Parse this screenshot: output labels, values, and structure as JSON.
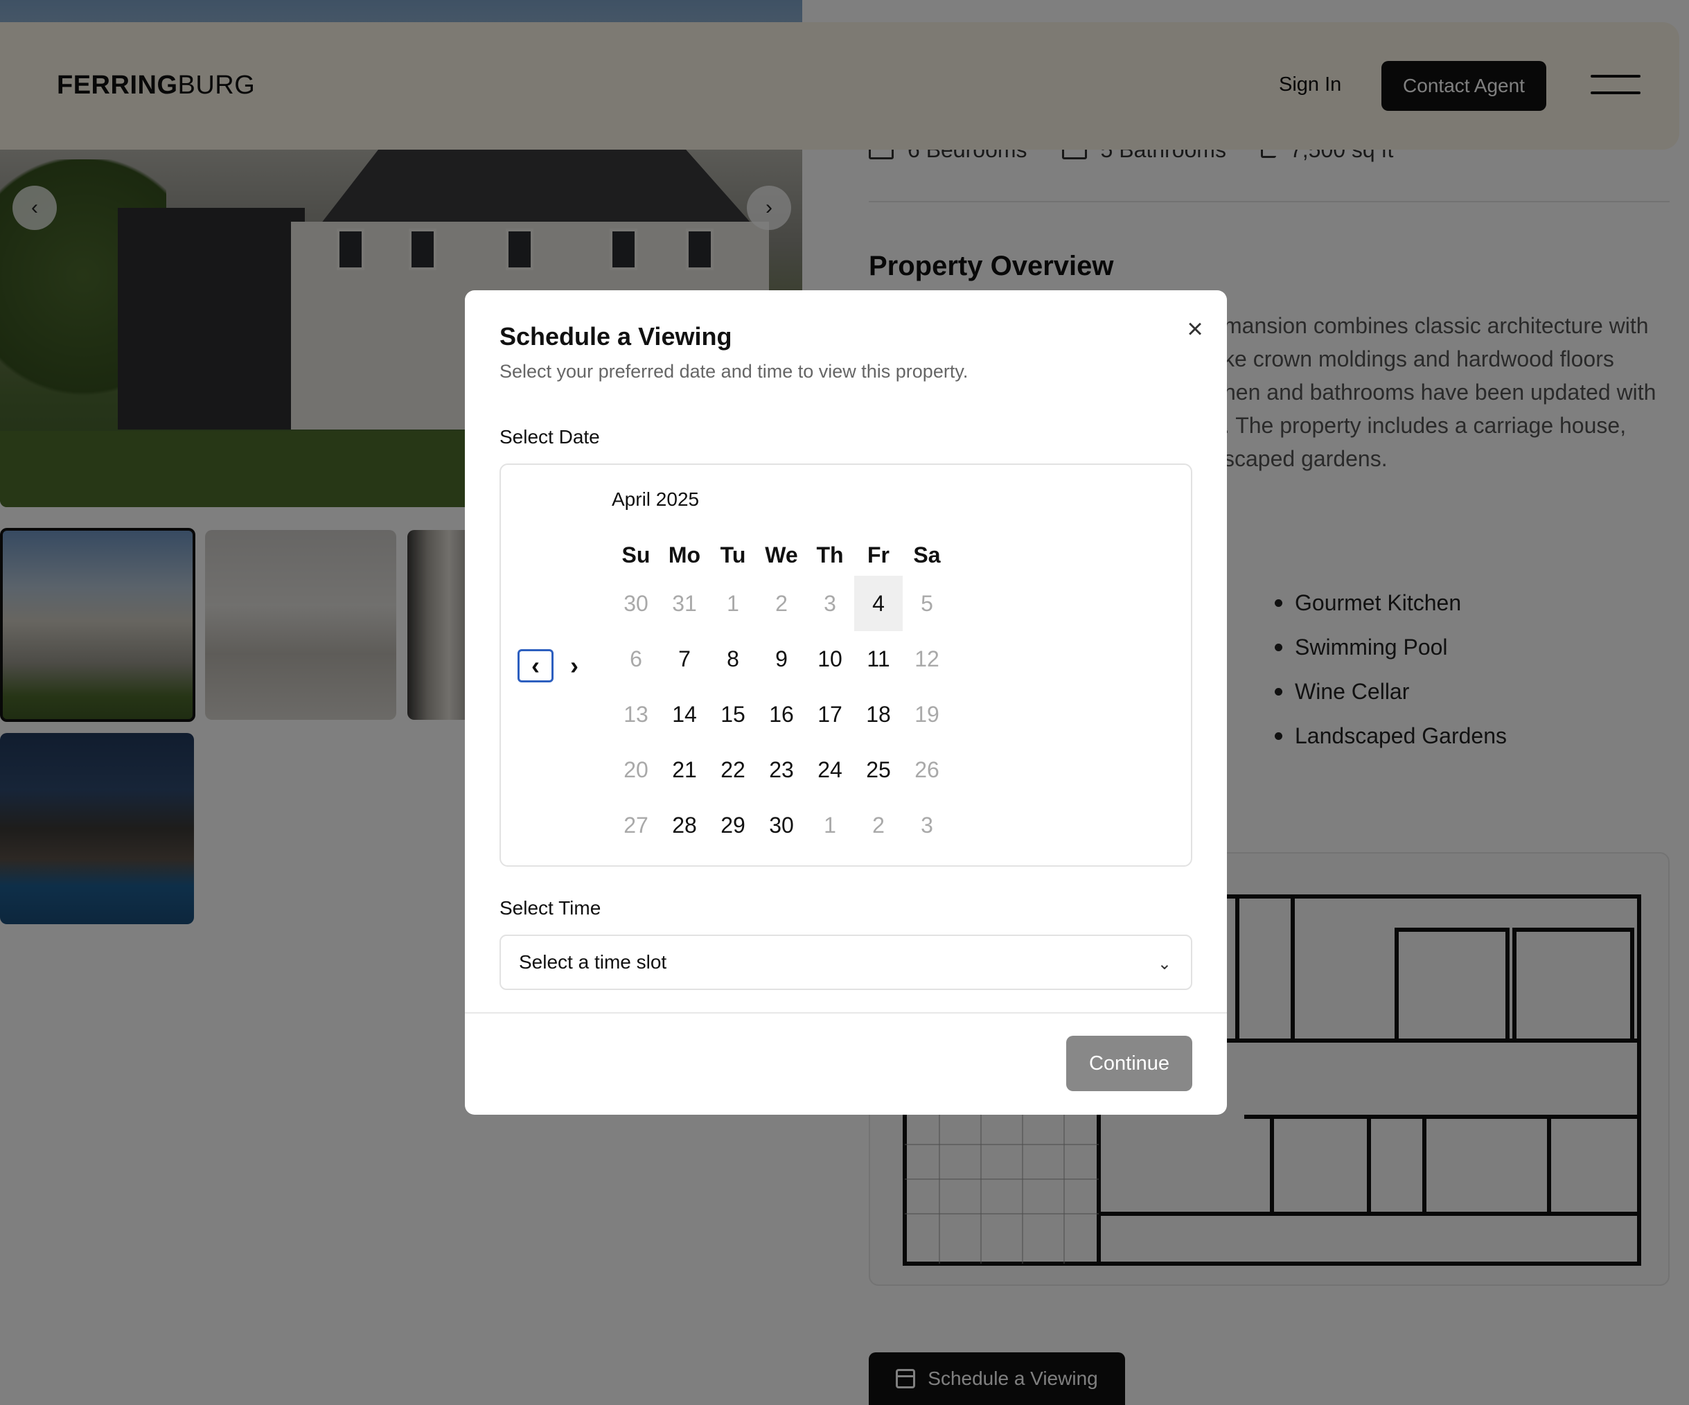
{
  "header": {
    "logo_bold": "FERRING",
    "logo_regular": "BURG",
    "sign_in": "Sign In",
    "contact_agent": "Contact Agent"
  },
  "gallery": {
    "prev_icon": "chevron-left-icon",
    "next_icon": "chevron-right-icon",
    "thumbnails": [
      "exterior-front",
      "living-room",
      "interior-hall",
      "exterior-pool"
    ]
  },
  "property": {
    "stats": [
      {
        "icon": "bed-icon",
        "label": "6 Bedrooms"
      },
      {
        "icon": "bath-icon",
        "label": "5 Bathrooms"
      },
      {
        "icon": "area-icon",
        "label": "7,500 sq ft"
      }
    ],
    "overview_title": "Property Overview",
    "overview_lines": [
      "mansion combines classic architecture with",
      "ke crown moldings and hardwood floors",
      "hen and bathrooms have been updated with",
      ". The property includes a carriage house,",
      "scaped gardens."
    ],
    "features": [
      "Gourmet Kitchen",
      "Swimming Pool",
      "Wine Cellar",
      "Landscaped Gardens"
    ],
    "schedule_button": "Schedule a Viewing"
  },
  "modal": {
    "title": "Schedule a Viewing",
    "subtitle": "Select your preferred date and time to view this property.",
    "date_label": "Select Date",
    "time_label": "Select Time",
    "calendar": {
      "month": "April 2025",
      "weekdays": [
        "Su",
        "Mo",
        "Tu",
        "We",
        "Th",
        "Fr",
        "Sa"
      ],
      "weeks": [
        [
          {
            "d": "30",
            "m": true
          },
          {
            "d": "31",
            "m": true
          },
          {
            "d": "1",
            "m": true
          },
          {
            "d": "2",
            "m": true
          },
          {
            "d": "3",
            "m": true
          },
          {
            "d": "4",
            "today": true
          },
          {
            "d": "5",
            "m": true
          }
        ],
        [
          {
            "d": "6",
            "m": true
          },
          {
            "d": "7"
          },
          {
            "d": "8"
          },
          {
            "d": "9"
          },
          {
            "d": "10"
          },
          {
            "d": "11"
          },
          {
            "d": "12",
            "m": true
          }
        ],
        [
          {
            "d": "13",
            "m": true
          },
          {
            "d": "14"
          },
          {
            "d": "15"
          },
          {
            "d": "16"
          },
          {
            "d": "17"
          },
          {
            "d": "18"
          },
          {
            "d": "19",
            "m": true
          }
        ],
        [
          {
            "d": "20",
            "m": true
          },
          {
            "d": "21"
          },
          {
            "d": "22"
          },
          {
            "d": "23"
          },
          {
            "d": "24"
          },
          {
            "d": "25"
          },
          {
            "d": "26",
            "m": true
          }
        ],
        [
          {
            "d": "27",
            "m": true
          },
          {
            "d": "28"
          },
          {
            "d": "29"
          },
          {
            "d": "30"
          },
          {
            "d": "1",
            "m": true
          },
          {
            "d": "2",
            "m": true
          },
          {
            "d": "3",
            "m": true
          }
        ]
      ]
    },
    "time_placeholder": "Select a time slot",
    "continue": "Continue"
  }
}
